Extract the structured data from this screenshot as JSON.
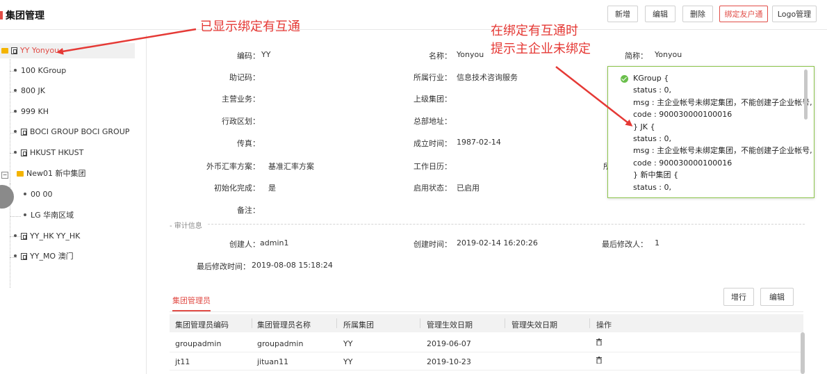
{
  "header": {
    "title": "集团管理",
    "buttons": [
      "新增",
      "编辑",
      "删除",
      "绑定友户通",
      "Logo管理"
    ]
  },
  "tree": {
    "items": [
      "YY Yonyou",
      "100 KGroup",
      "800 JK",
      "999 KH",
      "BOCI GROUP BOCI GROUP",
      "HKUST HKUST",
      "New01 新中集团",
      "00 00",
      "LG 华南区域",
      "YY_HK YY_HK",
      "YY_MO 澳门"
    ]
  },
  "form": {
    "code_label": "编码：",
    "code_value": "YY",
    "name_label": "名称：",
    "name_value": "Yonyou",
    "short_label": "简称：",
    "short_value": "Yonyou",
    "mnemonic_label": "助记码：",
    "industry_label": "所属行业：",
    "industry_value": "信息技术咨询服务",
    "business_label": "主营业务：",
    "parent_label": "上级集团：",
    "region_label": "行政区划：",
    "address_label": "总部地址：",
    "fax_label": "传真：",
    "founded_label": "成立时间：",
    "founded_value": "1987-02-14",
    "fx_label": "外币汇率方案：",
    "fx_value": "基准汇率方案",
    "calendar_label": "工作日历：",
    "calendar_right_partial": "所",
    "init_label": "初始化完成：",
    "init_value": "是",
    "status_label": "启用状态：",
    "status_value": "已启用",
    "remark_label": "备注：",
    "audit_title": "- 审计信息",
    "creator_label": "创建人：",
    "creator_value": "admin1",
    "created_label": "创建时间：",
    "created_value": "2019-02-14 16:20:26",
    "modifier_label": "最后修改人：",
    "modifier_value": "1",
    "modified_label": "最后修改时间：",
    "modified_value": "2019-08-08 15:18:24"
  },
  "admin_section": {
    "tab_label": "集团管理员",
    "add_row_button": "增行",
    "edit_button": "编辑",
    "columns": [
      "集团管理员编码",
      "集团管理员名称",
      "所属集团",
      "管理生效日期",
      "管理失效日期",
      "操作"
    ],
    "rows": [
      [
        "groupadmin",
        "groupadmin",
        "YY",
        "2019-06-07",
        ""
      ],
      [
        "jt11",
        "jituan11",
        "YY",
        "2019-10-23",
        ""
      ]
    ]
  },
  "tooltip": {
    "text": "KGroup {\nstatus : 0,\nmsg : 主企业帐号未绑定集团，不能创建子企业帐号,\ncode : 900030000100016\n} JK {\nstatus : 0,\nmsg : 主企业帐号未绑定集团，不能创建子企业帐号,\ncode : 900030000100016\n} 新中集团 {\nstatus : 0,"
  },
  "annotations": {
    "left": "已显示绑定有互通",
    "right_line1": "在绑定有互通时",
    "right_line2": "提示主企业未绑定"
  },
  "colors": {
    "accent": "#e14c46",
    "annotation": "#e53935",
    "success": "#6abf4b"
  }
}
